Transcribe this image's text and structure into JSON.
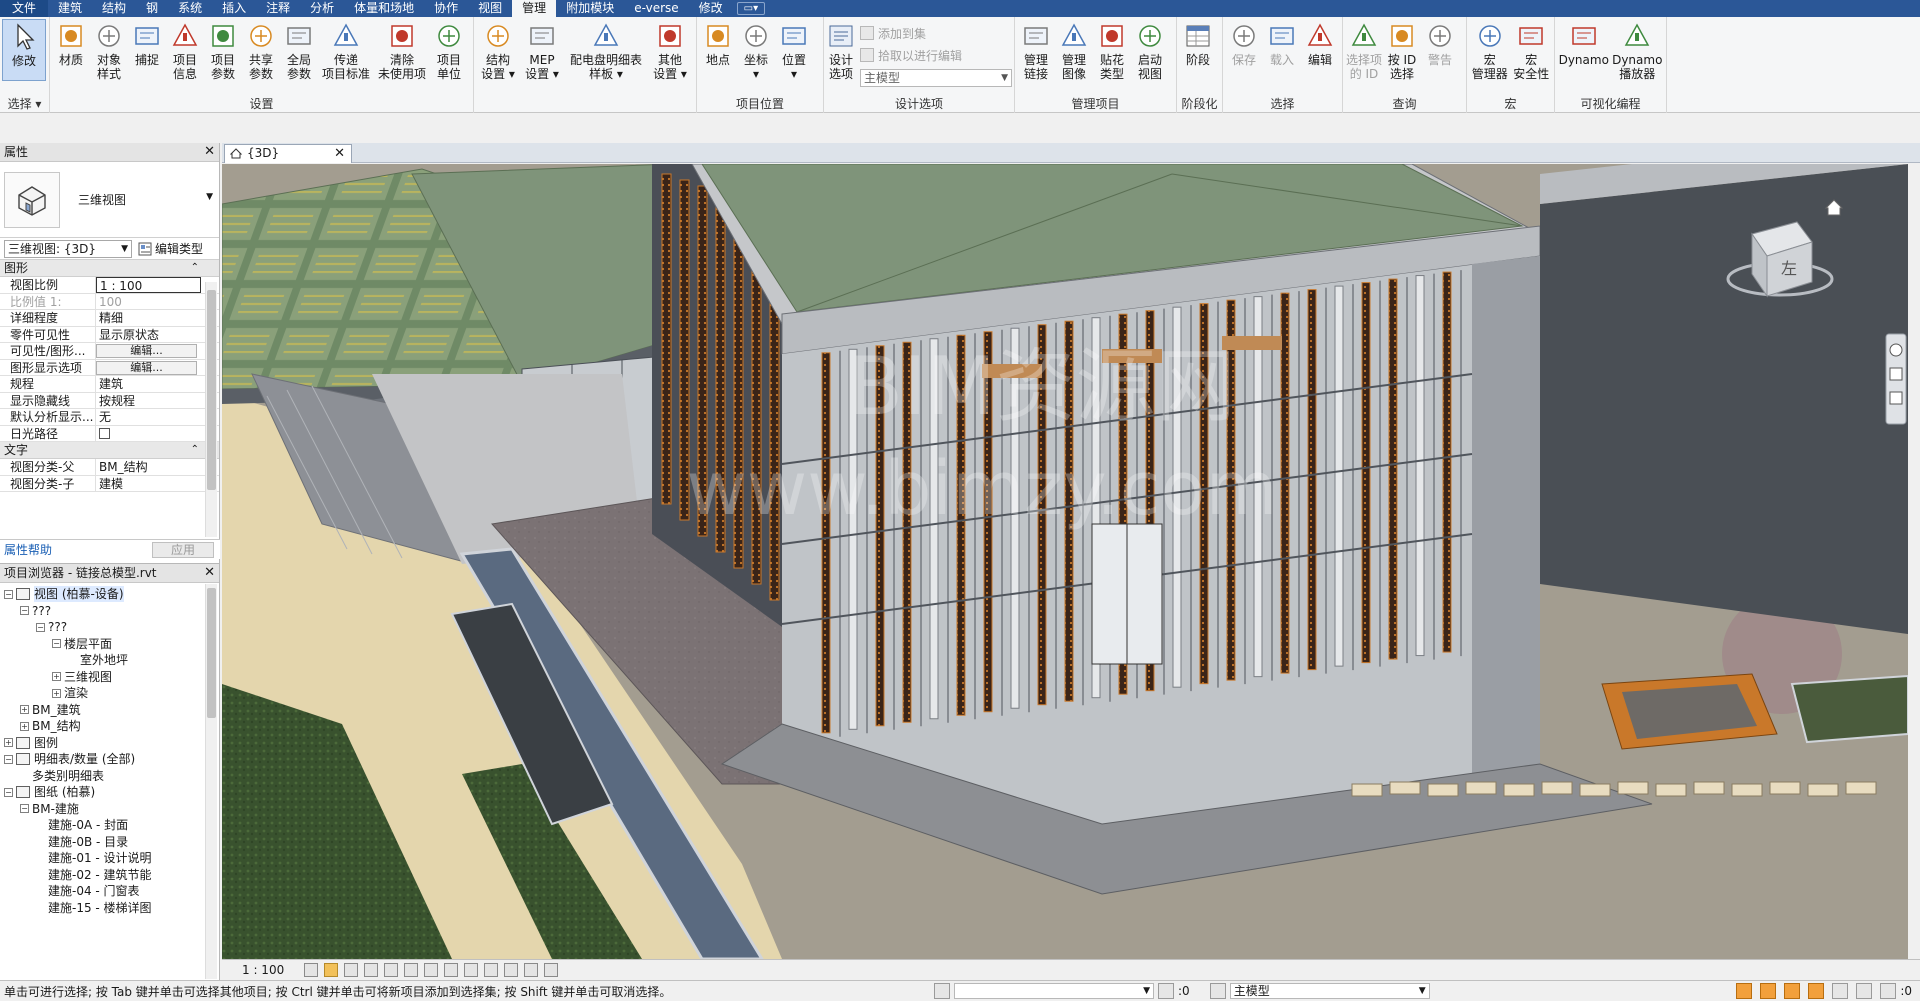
{
  "ribbon_tabs": [
    "文件",
    "建筑",
    "结构",
    "钢",
    "系统",
    "插入",
    "注释",
    "分析",
    "体量和场地",
    "协作",
    "视图",
    "管理",
    "附加模块",
    "e-verse",
    "修改"
  ],
  "active_tab": "管理",
  "ribbon": {
    "select": {
      "modify": "修改",
      "label": "选择 ▾"
    },
    "settings": {
      "label": "设置",
      "buttons": [
        {
          "l1": "材质",
          "l2": ""
        },
        {
          "l1": "对象",
          "l2": "样式"
        },
        {
          "l1": "捕捉",
          "l2": ""
        },
        {
          "l1": "项目",
          "l2": "信息"
        },
        {
          "l1": "项目",
          "l2": "参数"
        },
        {
          "l1": "共享",
          "l2": "参数"
        },
        {
          "l1": "全局",
          "l2": "参数"
        },
        {
          "l1": "传递",
          "l2": "项目标准"
        },
        {
          "l1": "清除",
          "l2": "未使用项"
        },
        {
          "l1": "项目",
          "l2": "单位"
        }
      ],
      "more": [
        {
          "l1": "结构",
          "l2": "设置 ▾"
        },
        {
          "l1": "MEP",
          "l2": "设置 ▾"
        },
        {
          "l1": "配电盘明细表",
          "l2": "样板 ▾"
        },
        {
          "l1": "其他",
          "l2": "设置 ▾"
        }
      ]
    },
    "project_location": {
      "label": "项目位置",
      "buttons": [
        {
          "l1": "地点",
          "l2": ""
        },
        {
          "l1": "坐标",
          "l2": "▾"
        },
        {
          "l1": "位置",
          "l2": "▾"
        }
      ]
    },
    "design_options": {
      "label": "设计选项",
      "design_btn_l1": "设计",
      "design_btn_l2": "选项",
      "add_to_set": "添加到集",
      "pick_to_edit": "拾取以进行编辑",
      "main_model": "主模型"
    },
    "manage_project": {
      "label": "管理项目",
      "buttons": [
        {
          "l1": "管理",
          "l2": "链接"
        },
        {
          "l1": "管理",
          "l2": "图像"
        },
        {
          "l1": "贴花",
          "l2": "类型"
        },
        {
          "l1": "启动",
          "l2": "视图"
        }
      ]
    },
    "phasing": {
      "label": "阶段化",
      "button": "阶段"
    },
    "selection": {
      "label": "选择",
      "buttons": [
        {
          "l1": "保存",
          "dim": true
        },
        {
          "l1": "载入",
          "dim": true
        },
        {
          "l1": "编辑",
          "dim": false
        }
      ]
    },
    "inquiry": {
      "label": "查询",
      "buttons": [
        {
          "l1": "选择项",
          "l2": "的 ID",
          "dim": true
        },
        {
          "l1": "按 ID",
          "l2": "选择",
          "dim": false
        },
        {
          "l1": "警告",
          "l2": "",
          "dim": true
        }
      ]
    },
    "macros": {
      "label": "宏",
      "buttons": [
        {
          "l1": "宏",
          "l2": "管理器"
        },
        {
          "l1": "宏",
          "l2": "安全性"
        }
      ]
    },
    "visual_programming": {
      "label": "可视化编程",
      "buttons": [
        {
          "l1": "Dynamo",
          "l2": ""
        },
        {
          "l1": "Dynamo",
          "l2": "播放器"
        }
      ]
    }
  },
  "properties": {
    "title": "属性",
    "type_name": "三维视图",
    "instance_selector": "三维视图: {3D}",
    "edit_type": "编辑类型",
    "groups": [
      {
        "name": "图形",
        "rows": [
          {
            "name": "视图比例",
            "value": "1 : 100",
            "editing": true
          },
          {
            "name": "比例值 1:",
            "value": "100",
            "dim": true
          },
          {
            "name": "详细程度",
            "value": "精细"
          },
          {
            "name": "零件可见性",
            "value": "显示原状态"
          },
          {
            "name": "可见性/图形...",
            "button": "编辑..."
          },
          {
            "name": "图形显示选项",
            "button": "编辑..."
          },
          {
            "name": "规程",
            "value": "建筑"
          },
          {
            "name": "显示隐藏线",
            "value": "按规程"
          },
          {
            "name": "默认分析显示...",
            "value": "无"
          },
          {
            "name": "日光路径",
            "checkbox": true
          }
        ]
      },
      {
        "name": "文字",
        "rows": [
          {
            "name": "视图分类-父",
            "value": "BM_结构"
          },
          {
            "name": "视图分类-子",
            "value": "建模"
          }
        ]
      }
    ],
    "help": "属性帮助",
    "apply": "应用"
  },
  "browser": {
    "title": "项目浏览器 - 链接总模型.rvt",
    "items": [
      {
        "level": 0,
        "toggle": "−",
        "label": "视图 (柏慕-设备)",
        "icon": true,
        "sel": true
      },
      {
        "level": 1,
        "toggle": "−",
        "label": "???"
      },
      {
        "level": 2,
        "toggle": "−",
        "label": "???"
      },
      {
        "level": 3,
        "toggle": "−",
        "label": "楼层平面"
      },
      {
        "level": 4,
        "toggle": "",
        "label": "室外地坪"
      },
      {
        "level": 3,
        "toggle": "+",
        "label": "三维视图"
      },
      {
        "level": 3,
        "toggle": "+",
        "label": "渲染"
      },
      {
        "level": 1,
        "toggle": "+",
        "label": "BM_建筑"
      },
      {
        "level": 1,
        "toggle": "+",
        "label": "BM_结构"
      },
      {
        "level": 0,
        "toggle": "+",
        "label": "图例",
        "icon": true
      },
      {
        "level": 0,
        "toggle": "−",
        "label": "明细表/数量 (全部)",
        "icon": true
      },
      {
        "level": 1,
        "toggle": "",
        "label": "多类别明细表"
      },
      {
        "level": 0,
        "toggle": "−",
        "label": "图纸 (柏慕)",
        "icon": true
      },
      {
        "level": 1,
        "toggle": "−",
        "label": "BM-建施"
      },
      {
        "level": 2,
        "toggle": "",
        "label": "建施-0A - 封面"
      },
      {
        "level": 2,
        "toggle": "",
        "label": "建施-0B - 目录"
      },
      {
        "level": 2,
        "toggle": "",
        "label": "建施-01 - 设计说明"
      },
      {
        "level": 2,
        "toggle": "",
        "label": "建施-02 - 建筑节能"
      },
      {
        "level": 2,
        "toggle": "",
        "label": "建施-04 - 门窗表"
      },
      {
        "level": 2,
        "toggle": "",
        "label": "建施-15 - 楼梯详图"
      }
    ]
  },
  "view": {
    "tab_label": "{3D}",
    "watermark_line1": "BIM资源网",
    "watermark_line2": "www.bimzy.com",
    "viewcube_label": "左",
    "scale": "1 : 100"
  },
  "status": {
    "message": "单击可进行选择; 按 Tab 键并单击可选择其他项目; 按 Ctrl 键并单击可将新项目添加到选择集; 按 Shift 键并单击可取消选择。",
    "count1": ":0",
    "model": "主模型",
    "count2": ":0"
  },
  "colors": {
    "tab_bar": "#2b5797",
    "roof": "#7f947a",
    "glass": "#c8ccd0",
    "wood_panel": "#3a2418",
    "accent_orange": "#c9782a"
  }
}
